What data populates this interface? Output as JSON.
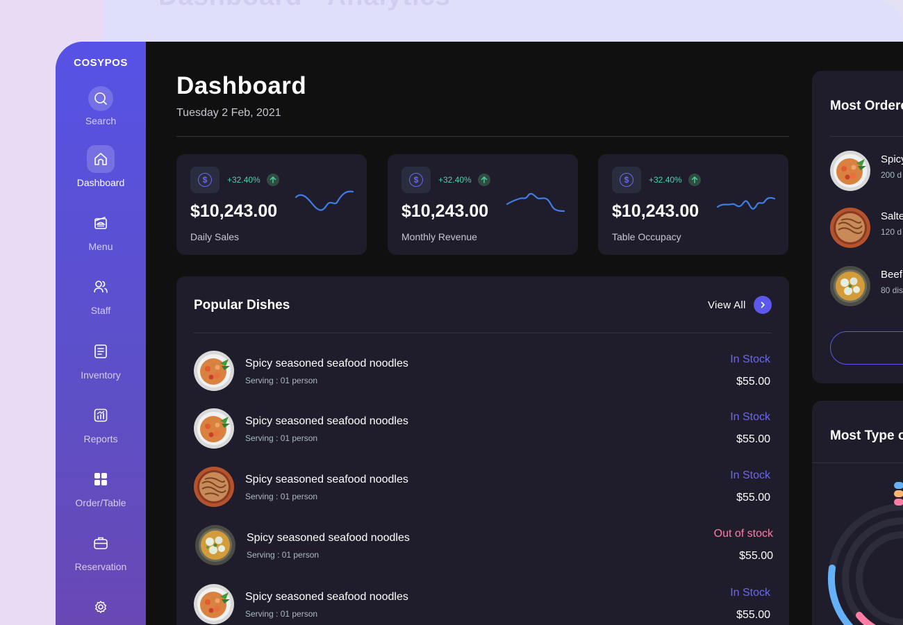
{
  "background": {
    "title": "Dashboard - Analytics"
  },
  "brand": "COSYPOS",
  "sidebar": {
    "items": [
      {
        "key": "search",
        "label": "Search",
        "icon": "search-icon",
        "active": false
      },
      {
        "key": "dashboard",
        "label": "Dashboard",
        "icon": "home-icon",
        "active": true
      },
      {
        "key": "menu",
        "label": "Menu",
        "icon": "menu-icon",
        "active": false
      },
      {
        "key": "staff",
        "label": "Staff",
        "icon": "users-icon",
        "active": false
      },
      {
        "key": "inventory",
        "label": "Inventory",
        "icon": "inventory-icon",
        "active": false
      },
      {
        "key": "reports",
        "label": "Reports",
        "icon": "reports-icon",
        "active": false
      },
      {
        "key": "order-table",
        "label": "Order/Table",
        "icon": "grid-icon",
        "active": false
      },
      {
        "key": "reservation",
        "label": "Reservation",
        "icon": "briefcase-icon",
        "active": false
      },
      {
        "key": "settings",
        "label": "",
        "icon": "gear-icon",
        "active": false
      }
    ]
  },
  "header": {
    "title": "Dashboard",
    "date": "Tuesday 2 Feb, 2021"
  },
  "stats": [
    {
      "change": "+32.40%",
      "value": "$10,243.00",
      "label": "Daily Sales"
    },
    {
      "change": "+32.40%",
      "value": "$10,243.00",
      "label": "Monthly Revenue"
    },
    {
      "change": "+32.40%",
      "value": "$10,243.00",
      "label": "Table Occupacy"
    }
  ],
  "popular": {
    "title": "Popular Dishes",
    "view_all": "View All",
    "dishes": [
      {
        "name": "Spicy seasoned seafood noodles",
        "serving": "Serving : 01 person",
        "status": "In Stock",
        "price": "$55.00",
        "image": "seafood-noodles"
      },
      {
        "name": "Spicy seasoned seafood noodles",
        "serving": "Serving : 01 person",
        "status": "In Stock",
        "price": "$55.00",
        "image": "seafood-noodles"
      },
      {
        "name": "Spicy seasoned seafood noodles",
        "serving": "Serving : 01 person",
        "status": "In Stock",
        "price": "$55.00",
        "image": "pasta"
      },
      {
        "name": "Spicy seasoned seafood noodles",
        "serving": "Serving : 01 person",
        "status": "Out of stock",
        "price": "$55.00",
        "image": "dumplings"
      },
      {
        "name": "Spicy seasoned seafood noodles",
        "serving": "Serving : 01 person",
        "status": "In Stock",
        "price": "$55.00",
        "image": "seafood-noodles"
      }
    ]
  },
  "most_ordered": {
    "title": "Most Ordered",
    "items": [
      {
        "name": "Spicy",
        "count": "200 d",
        "image": "seafood-noodles"
      },
      {
        "name": "Salte",
        "count": "120 d",
        "image": "pasta"
      },
      {
        "name": "Beef",
        "count": "80 dis",
        "image": "dumplings"
      }
    ]
  },
  "most_type": {
    "title": "Most Type of Order"
  },
  "colors": {
    "accent": "#5b58ea",
    "in_stock": "#6b67f2",
    "out_of_stock": "#ff7ca3",
    "positive": "#50d1aa",
    "sparkline": "#3f7ee8",
    "donut_pink": "#ff7ca3",
    "donut_orange": "#ffb572",
    "donut_blue": "#65b0f6"
  }
}
